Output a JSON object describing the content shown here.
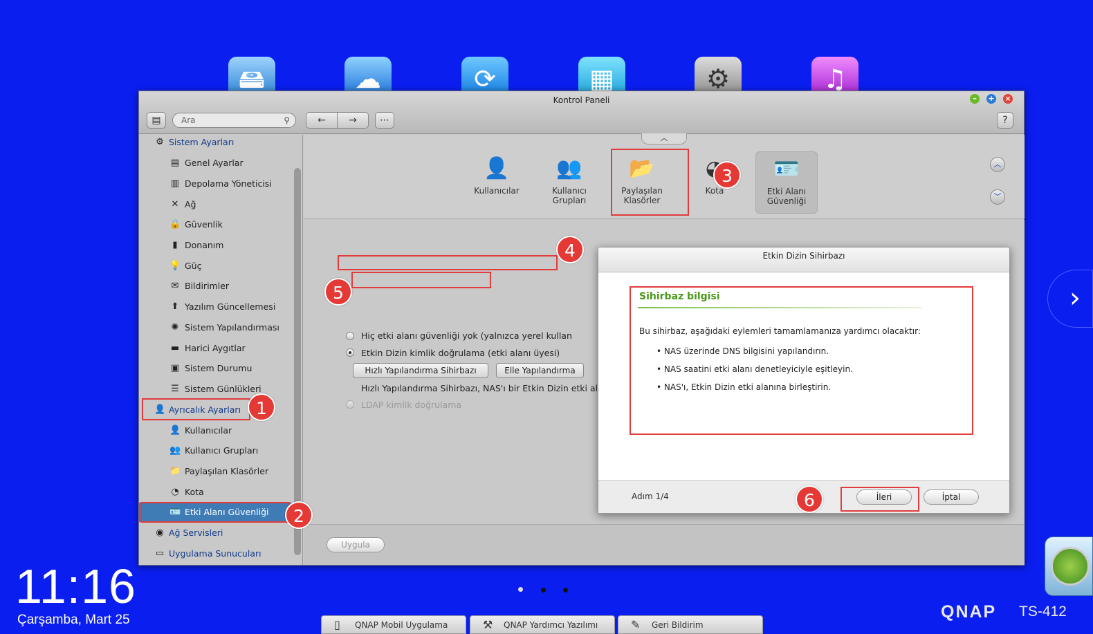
{
  "window": {
    "title": "Kontrol Paneli",
    "help": "?"
  },
  "toolbar": {
    "search_placeholder": "Ara",
    "back": "←",
    "forward": "→",
    "grid": "⋯"
  },
  "sidebar": {
    "items": [
      {
        "label": "Sistem Ayarları",
        "type": "category"
      },
      {
        "label": "Genel Ayarlar"
      },
      {
        "label": "Depolama Yöneticisi"
      },
      {
        "label": "Ağ"
      },
      {
        "label": "Güvenlik"
      },
      {
        "label": "Donanım"
      },
      {
        "label": "Güç"
      },
      {
        "label": "Bildirimler"
      },
      {
        "label": "Yazılım Güncellemesi"
      },
      {
        "label": "Sistem Yapılandırması"
      },
      {
        "label": "Harici Aygıtlar"
      },
      {
        "label": "Sistem Durumu"
      },
      {
        "label": "Sistem Günlükleri"
      },
      {
        "label": "Ayrıcalık Ayarları",
        "type": "category"
      },
      {
        "label": "Kullanıcılar"
      },
      {
        "label": "Kullanıcı Grupları"
      },
      {
        "label": "Paylaşılan Klasörler"
      },
      {
        "label": "Kota"
      },
      {
        "label": "Etki Alanı Güvenliği",
        "selected": true
      },
      {
        "label": "Ağ Servisleri",
        "type": "category"
      },
      {
        "label": "Uygulama Sunucuları",
        "type": "category"
      }
    ]
  },
  "module_icons": [
    {
      "line1": "Kullanıcılar",
      "line2": ""
    },
    {
      "line1": "Kullanıcı",
      "line2": "Grupları"
    },
    {
      "line1": "Paylaşılan",
      "line2": "Klasörler"
    },
    {
      "line1": "Kota",
      "line2": ""
    },
    {
      "line1": "Etki Alanı",
      "line2": "Güvenliği"
    }
  ],
  "content": {
    "option_none": "Hiç etki alanı güvenliği yok (yalnızca yerel kullan",
    "option_ad": "Etkin Dizin kimlik doğrulama (etki alanı üyesi)",
    "quick_wizard_button": "Hızlı Yapılandırma Sihirbazı",
    "manual_config_button": "Elle Yapılandırma",
    "description": "Hızlı Yapılandırma Sihirbazı, NAS'ı bir Etkin Dizin etki alanın",
    "option_ldap": "LDAP kimlik doğrulama",
    "apply_button": "Uygula"
  },
  "dialog": {
    "title": "Etkin Dizin Sihirbazı",
    "section_title": "Sihirbaz bilgisi",
    "intro": "Bu sihirbaz, aşağıdaki eylemleri tamamlamanıza yardımcı olacaktır:",
    "bullets": [
      "NAS üzerinde DNS bilgisini yapılandırın.",
      "NAS saatini etki alanı denetleyiciyle eşitleyin.",
      "NAS'ı, Etkin Dizin etki alanına birleştirin."
    ],
    "step": "Adım 1/4",
    "next_button": "İleri",
    "cancel_button": "İptal"
  },
  "badges": [
    "1",
    "2",
    "3",
    "4",
    "5",
    "6"
  ],
  "clock": {
    "time": "11:16",
    "date": "Çarşamba, Mart 25"
  },
  "taskbar": [
    {
      "label": "QNAP Mobil Uygulama"
    },
    {
      "label": "QNAP Yardımcı Yazılımı"
    },
    {
      "label": "Geri Bildirim"
    }
  ],
  "brand": {
    "name": "QNAP",
    "model": "TS-412"
  },
  "colors": {
    "desktop": "#0a1ef0",
    "selection": "#3f7cb5",
    "highlight_box": "#e23b3b",
    "badge": "#e53935",
    "section_title": "#4a9a1a"
  }
}
